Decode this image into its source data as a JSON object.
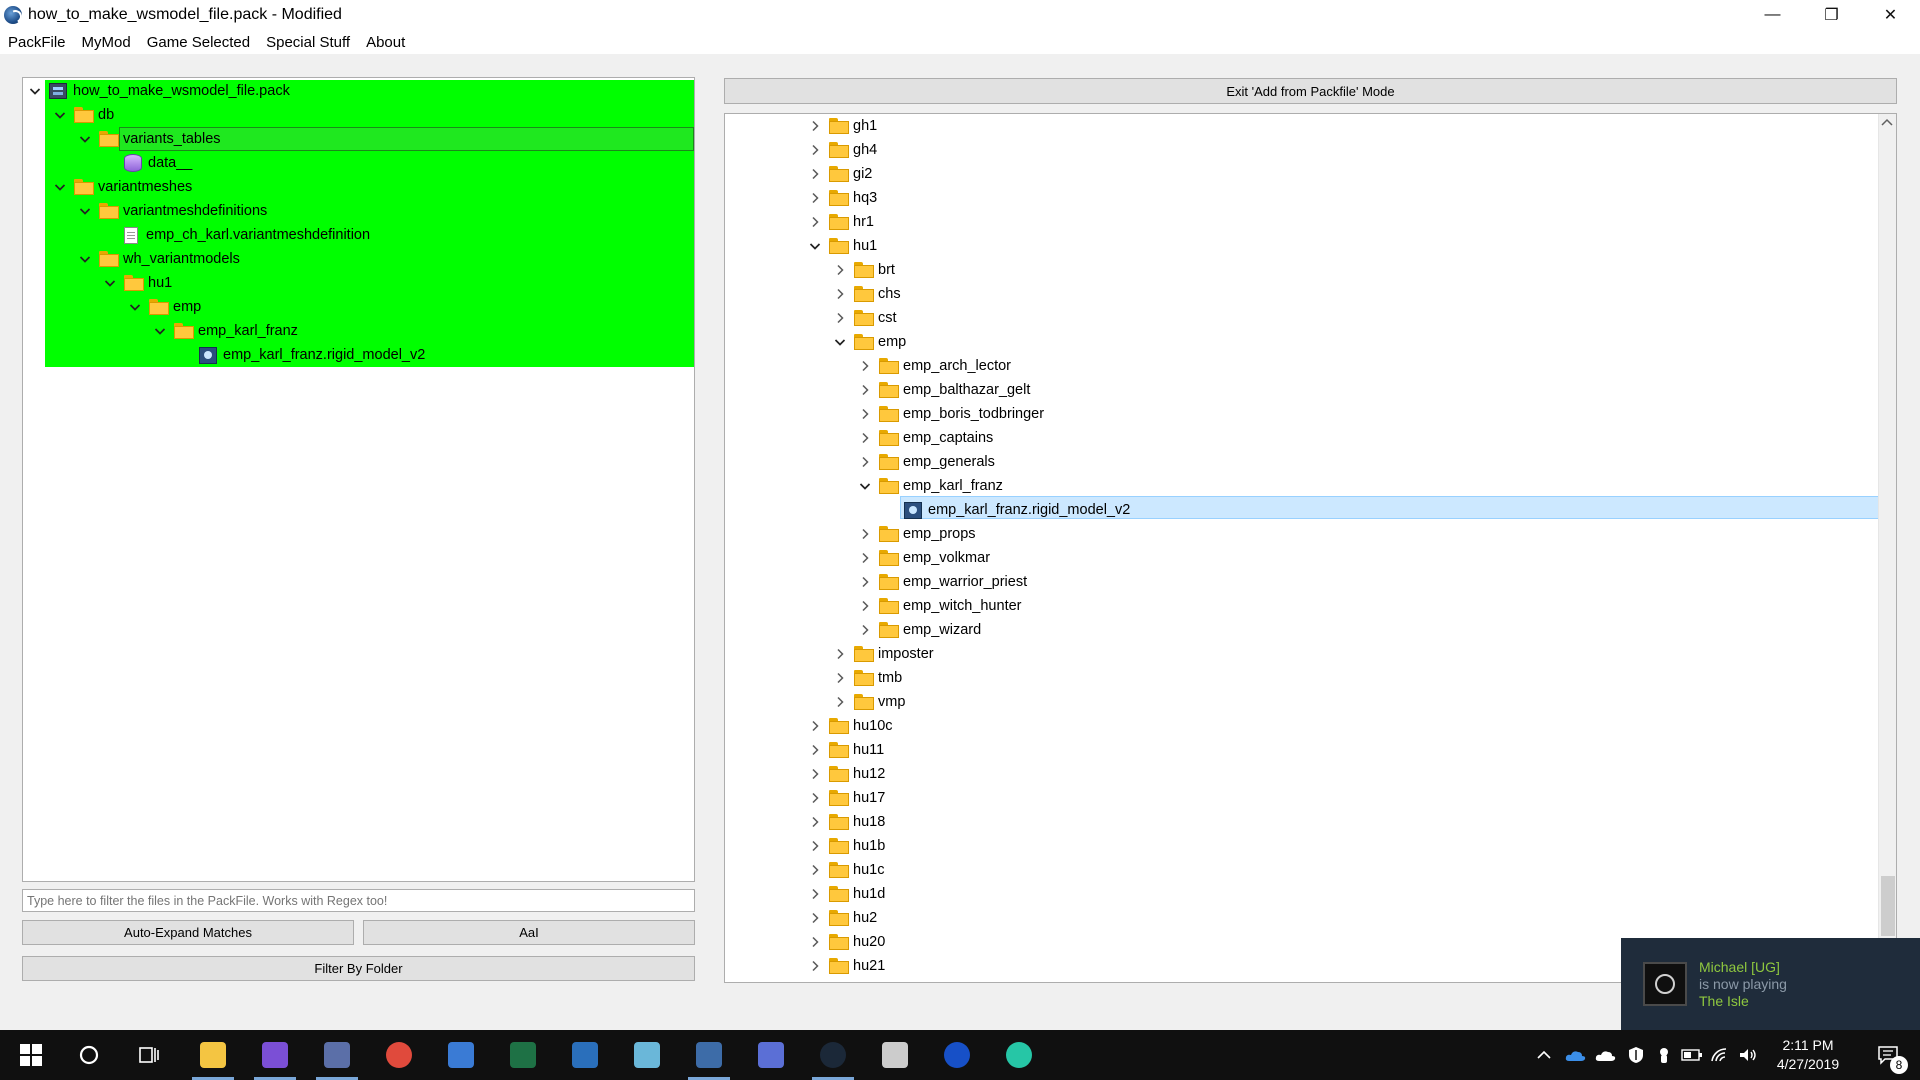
{
  "window": {
    "title": "how_to_make_wsmodel_file.pack - Modified",
    "minimize": "—",
    "maximize": "❐",
    "close": "✕"
  },
  "menu": [
    "PackFile",
    "MyMod",
    "Game Selected",
    "Special Stuff",
    "About"
  ],
  "left_tree": [
    {
      "label": "how_to_make_wsmodel_file.pack",
      "icon": "pack-icon",
      "depth": 0,
      "expanded": true
    },
    {
      "label": "db",
      "icon": "folder-icon",
      "depth": 1,
      "expanded": true
    },
    {
      "label": "variants_tables",
      "icon": "folder-icon",
      "depth": 2,
      "expanded": true,
      "selected": true
    },
    {
      "label": "data__",
      "icon": "database-icon",
      "depth": 3
    },
    {
      "label": "variantmeshes",
      "icon": "folder-icon",
      "depth": 1,
      "expanded": true
    },
    {
      "label": "variantmeshdefinitions",
      "icon": "folder-icon",
      "depth": 2,
      "expanded": true
    },
    {
      "label": "emp_ch_karl.variantmeshdefinition",
      "icon": "document-icon",
      "depth": 3
    },
    {
      "label": "wh_variantmodels",
      "icon": "folder-icon",
      "depth": 2,
      "expanded": true
    },
    {
      "label": "hu1",
      "icon": "folder-icon",
      "depth": 3,
      "expanded": true
    },
    {
      "label": "emp",
      "icon": "folder-icon",
      "depth": 4,
      "expanded": true
    },
    {
      "label": "emp_karl_franz",
      "icon": "folder-icon",
      "depth": 5,
      "expanded": true
    },
    {
      "label": "emp_karl_franz.rigid_model_v2",
      "icon": "model-icon",
      "depth": 6
    }
  ],
  "filter": {
    "placeholder": "Type here to filter the files in the PackFile. Works with Regex too!",
    "auto_expand": "Auto-Expand Matches",
    "case_toggle": "AaI",
    "filter_by_folder": "Filter By Folder"
  },
  "right": {
    "exit_button": "Exit 'Add from Packfile' Mode"
  },
  "right_tree": [
    {
      "label": "gh1",
      "depth": 0,
      "expanded": false
    },
    {
      "label": "gh4",
      "depth": 0,
      "expanded": false
    },
    {
      "label": "gi2",
      "depth": 0,
      "expanded": false
    },
    {
      "label": "hq3",
      "depth": 0,
      "expanded": false
    },
    {
      "label": "hr1",
      "depth": 0,
      "expanded": false
    },
    {
      "label": "hu1",
      "depth": 0,
      "expanded": true
    },
    {
      "label": "brt",
      "depth": 1,
      "expanded": false
    },
    {
      "label": "chs",
      "depth": 1,
      "expanded": false
    },
    {
      "label": "cst",
      "depth": 1,
      "expanded": false
    },
    {
      "label": "emp",
      "depth": 1,
      "expanded": true
    },
    {
      "label": "emp_arch_lector",
      "depth": 2,
      "expanded": false
    },
    {
      "label": "emp_balthazar_gelt",
      "depth": 2,
      "expanded": false
    },
    {
      "label": "emp_boris_todbringer",
      "depth": 2,
      "expanded": false
    },
    {
      "label": "emp_captains",
      "depth": 2,
      "expanded": false
    },
    {
      "label": "emp_generals",
      "depth": 2,
      "expanded": false
    },
    {
      "label": "emp_karl_franz",
      "depth": 2,
      "expanded": true
    },
    {
      "label": "emp_karl_franz.rigid_model_v2",
      "depth": 3,
      "file": true,
      "selected": true
    },
    {
      "label": "emp_props",
      "depth": 2,
      "expanded": false
    },
    {
      "label": "emp_volkmar",
      "depth": 2,
      "expanded": false
    },
    {
      "label": "emp_warrior_priest",
      "depth": 2,
      "expanded": false
    },
    {
      "label": "emp_witch_hunter",
      "depth": 2,
      "expanded": false
    },
    {
      "label": "emp_wizard",
      "depth": 2,
      "expanded": false
    },
    {
      "label": "imposter",
      "depth": 1,
      "expanded": false
    },
    {
      "label": "tmb",
      "depth": 1,
      "expanded": false
    },
    {
      "label": "vmp",
      "depth": 1,
      "expanded": false
    },
    {
      "label": "hu10c",
      "depth": 0,
      "expanded": false
    },
    {
      "label": "hu11",
      "depth": 0,
      "expanded": false
    },
    {
      "label": "hu12",
      "depth": 0,
      "expanded": false
    },
    {
      "label": "hu17",
      "depth": 0,
      "expanded": false
    },
    {
      "label": "hu18",
      "depth": 0,
      "expanded": false
    },
    {
      "label": "hu1b",
      "depth": 0,
      "expanded": false
    },
    {
      "label": "hu1c",
      "depth": 0,
      "expanded": false
    },
    {
      "label": "hu1d",
      "depth": 0,
      "expanded": false
    },
    {
      "label": "hu2",
      "depth": 0,
      "expanded": false
    },
    {
      "label": "hu20",
      "depth": 0,
      "expanded": false
    },
    {
      "label": "hu21",
      "depth": 0,
      "expanded": false
    }
  ],
  "notification": {
    "name": "Michael [UG]",
    "status": "is now playing",
    "game": "The Isle"
  },
  "taskbar": {
    "apps": [
      {
        "name": "file-explorer-icon",
        "color": "#f4c542"
      },
      {
        "name": "editor-icon",
        "color": "#7b4fd6"
      },
      {
        "name": "lock-app-icon",
        "color": "#5b6fa8"
      },
      {
        "name": "chrome-icon",
        "color": "#e04a3c"
      },
      {
        "name": "network-app-icon",
        "color": "#3a7bd5"
      },
      {
        "name": "excel-icon",
        "color": "#1e7145"
      },
      {
        "name": "tool-app-icon",
        "color": "#2a6fbb"
      },
      {
        "name": "notes-app-icon",
        "color": "#6ab7d9"
      },
      {
        "name": "rpfm-icon",
        "color": "#3d6ca8"
      },
      {
        "name": "camera-app-icon",
        "color": "#5b6fd6"
      },
      {
        "name": "steam-icon",
        "color": "#1b2838"
      },
      {
        "name": "game-app-icon",
        "color": "#cccccc"
      },
      {
        "name": "uplay-icon",
        "color": "#1750c7"
      },
      {
        "name": "brain-app-icon",
        "color": "#26c6a6"
      }
    ],
    "time": "2:11 PM",
    "date": "4/27/2019",
    "notifications_count": "8"
  }
}
